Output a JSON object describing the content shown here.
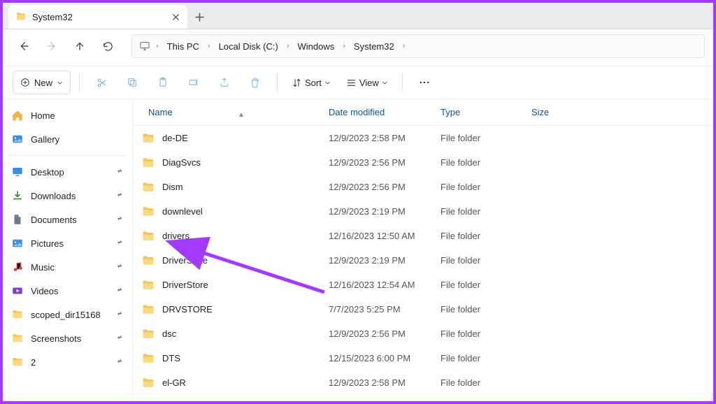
{
  "tab": {
    "title": "System32"
  },
  "nav": {
    "crumbs": [
      "This PC",
      "Local Disk (C:)",
      "Windows",
      "System32"
    ]
  },
  "toolbar": {
    "new_label": "New",
    "sort_label": "Sort",
    "view_label": "View"
  },
  "sidebar": {
    "home": "Home",
    "gallery": "Gallery",
    "quick": [
      {
        "label": "Desktop",
        "icon": "desktop"
      },
      {
        "label": "Downloads",
        "icon": "downloads"
      },
      {
        "label": "Documents",
        "icon": "documents"
      },
      {
        "label": "Pictures",
        "icon": "pictures"
      },
      {
        "label": "Music",
        "icon": "music"
      },
      {
        "label": "Videos",
        "icon": "videos"
      },
      {
        "label": "scoped_dir15168",
        "icon": "folder"
      },
      {
        "label": "Screenshots",
        "icon": "folder"
      },
      {
        "label": "2",
        "icon": "folder"
      }
    ]
  },
  "columns": {
    "name": "Name",
    "date_modified": "Date modified",
    "type": "Type",
    "size": "Size"
  },
  "rows": [
    {
      "name": "de-DE",
      "date": "12/9/2023 2:58 PM",
      "type": "File folder"
    },
    {
      "name": "DiagSvcs",
      "date": "12/9/2023 2:56 PM",
      "type": "File folder"
    },
    {
      "name": "Dism",
      "date": "12/9/2023 2:56 PM",
      "type": "File folder"
    },
    {
      "name": "downlevel",
      "date": "12/9/2023 2:19 PM",
      "type": "File folder"
    },
    {
      "name": "drivers",
      "date": "12/16/2023 12:50 AM",
      "type": "File folder"
    },
    {
      "name": "DriverState",
      "date": "12/9/2023 2:19 PM",
      "type": "File folder"
    },
    {
      "name": "DriverStore",
      "date": "12/16/2023 12:54 AM",
      "type": "File folder"
    },
    {
      "name": "DRVSTORE",
      "date": "7/7/2023 5:25 PM",
      "type": "File folder"
    },
    {
      "name": "dsc",
      "date": "12/9/2023 2:56 PM",
      "type": "File folder"
    },
    {
      "name": "DTS",
      "date": "12/15/2023 6:00 PM",
      "type": "File folder"
    },
    {
      "name": "el-GR",
      "date": "12/9/2023 2:58 PM",
      "type": "File folder"
    }
  ],
  "annotation": {
    "target_row_index": 4
  }
}
